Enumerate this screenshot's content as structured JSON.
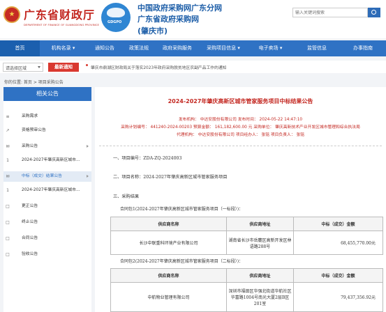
{
  "header": {
    "dept_name": "广东省财政厅",
    "dept_name_en": "DEPARTMENT OF FINANCE OF GUANGDONG PROVINCE",
    "logo_text": "GDGPO",
    "site_title_1": "中国政府采购网广东分网",
    "site_title_2": "广东省政府采购网",
    "site_title_3": "(肇庆市)",
    "search_placeholder": "输入关键词搜索"
  },
  "nav": {
    "items": [
      "首页",
      "机构名录 ▾",
      "通知公告",
      "政策法规",
      "政府采购服务",
      "采购项目信息 ▾",
      "电子卖场 ▾",
      "监管信息",
      "办事指南"
    ]
  },
  "ticker": {
    "region_select": "请选择区域",
    "urgent_label": "最新通知",
    "text": "肇庆市鼎湖区财政局关于落实2023年政府采购脱贫地区农副产品工作的通知"
  },
  "breadcrumb": "你的位置: 首页 > 项目采购公告",
  "sidebar": {
    "title": "相关公告",
    "items": [
      {
        "icon": "≡",
        "label": "采购需求"
      },
      {
        "icon": "↗",
        "label": "资格预审公告"
      },
      {
        "icon": "✉",
        "label": "采购公告"
      },
      {
        "icon": "1",
        "label": "2024-2027年肇庆高新区城市..."
      },
      {
        "icon": "✉",
        "label": "中标（成交）结果公告"
      },
      {
        "icon": "1",
        "label": "2024-2027年肇庆高新区城市..."
      },
      {
        "icon": "□",
        "label": "更正公告"
      },
      {
        "icon": "□",
        "label": "终止公告"
      },
      {
        "icon": "□",
        "label": "合同公告"
      },
      {
        "icon": "□",
        "label": "验收公告"
      }
    ]
  },
  "doc": {
    "title": "2024-2027年肇庆高新区城市管家服务项目中标结果公告",
    "meta1": "发布机构：  中达安股份有限公司          发布时间：  2024-05-22 14:47:10",
    "meta2": "采购计划编号：  441240-2024-00203    预算金额：  161,182,600.00 元    采购单位：  肇庆高新技术产业开发区城市管理和综合执法局",
    "meta3": "代理机构：  中达安股份有限公司          项目经办人：  张铭          项目负责人：  张铭",
    "sec1": "一、项目编号：ZDA-ZQ-2024003",
    "sec2": "二、项目名称：2024-2027年肇庆高新区城市管家服务项目",
    "sec3": "三、采购结果",
    "pkg1": "合同包1(2024-2027年肇庆高新区城市管家服务项目（一标段）)：",
    "pkg2": "合同包2(2024-2027年肇庆高新区城市管家服务项目（二标段）)：",
    "col_name": "供应商名称",
    "col_addr": "供应商地址",
    "col_amount": "中标（成交）金额",
    "row1": {
      "name": "长沙中联重科环境产业有限公司",
      "addr": "湖南省长沙市岳麓区高新开发区林语路288号",
      "amount": "68,455,770.00元"
    },
    "row2": {
      "name": "中航物业管理有限公司",
      "addr": "深圳市福田区华强北街道华航社区华富路1004号南光大厦2层B区201室",
      "amount": "79,437,356.92元"
    }
  }
}
